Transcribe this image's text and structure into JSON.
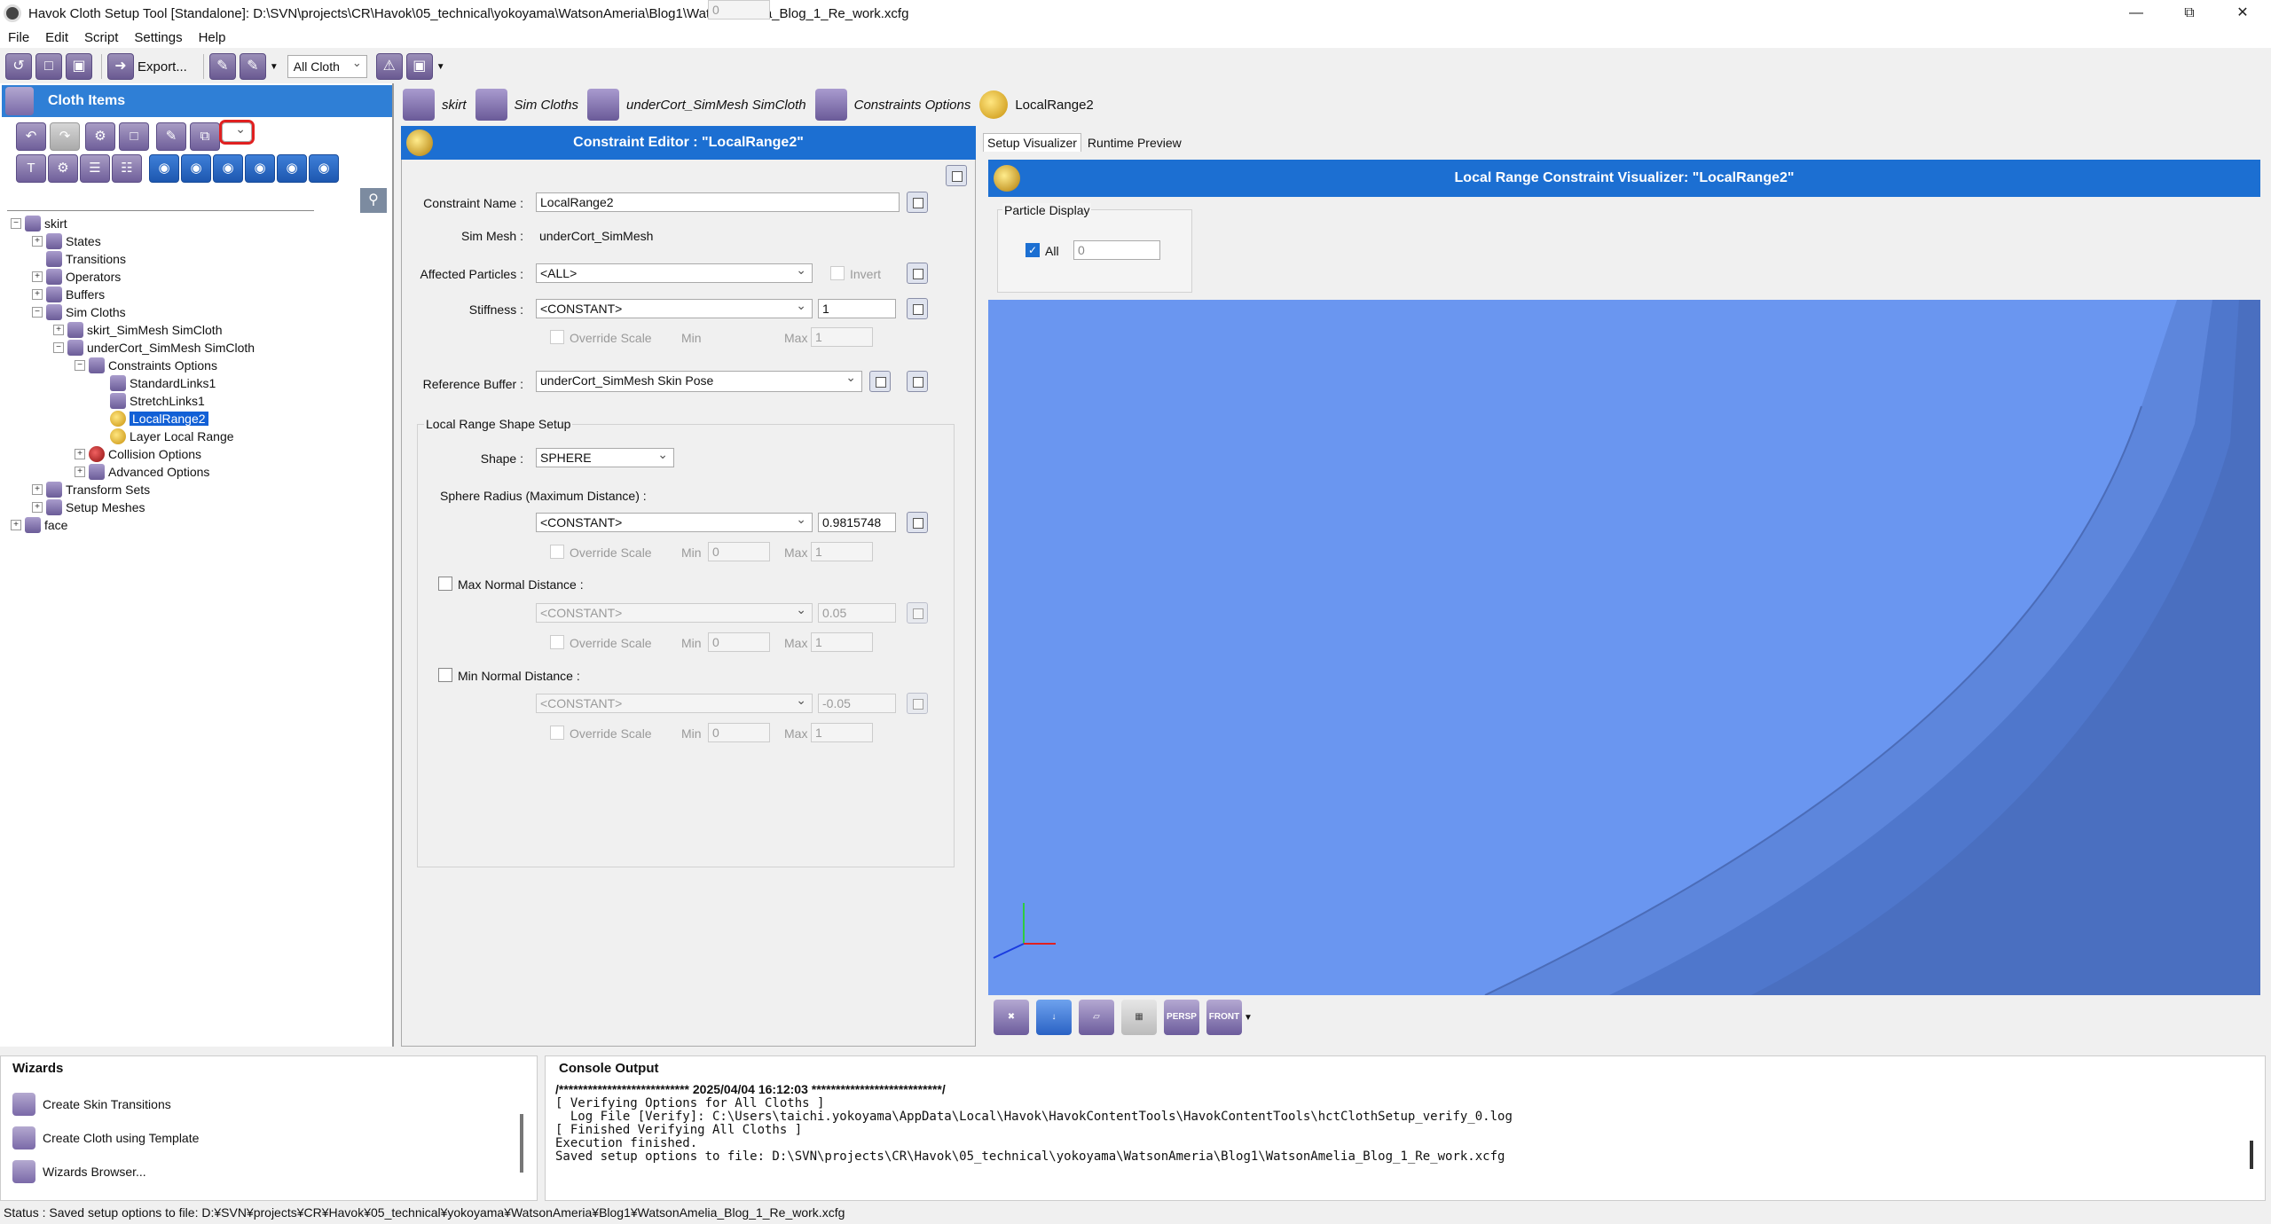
{
  "window": {
    "title": "Havok Cloth Setup Tool [Standalone]: D:\\SVN\\projects\\CR\\Havok\\05_technical\\yokoyama\\WatsonAmeria\\Blog1\\WatsonAmelia_Blog_1_Re_work.xcfg",
    "minimize": "—",
    "maximize": "⧉",
    "close": "✕"
  },
  "menu": [
    "File",
    "Edit",
    "Script",
    "Settings",
    "Help"
  ],
  "toolbar": {
    "export_label": "Export...",
    "cloth_filter": "All Cloth"
  },
  "cloth_items": {
    "title": "Cloth Items",
    "search_icon": "search-icon",
    "tree": [
      {
        "label": "skirt",
        "expander": "−"
      },
      {
        "label": "States",
        "expander": "+"
      },
      {
        "label": "Transitions",
        "expander": ""
      },
      {
        "label": "Operators",
        "expander": "+"
      },
      {
        "label": "Buffers",
        "expander": "+"
      },
      {
        "label": "Sim Cloths",
        "expander": "−"
      },
      {
        "label": "skirt_SimMesh SimCloth",
        "expander": "+"
      },
      {
        "label": "underCort_SimMesh SimCloth",
        "expander": "−"
      },
      {
        "label": "Constraints Options",
        "expander": "−"
      },
      {
        "label": "StandardLinks1",
        "expander": ""
      },
      {
        "label": "StretchLinks1",
        "expander": ""
      },
      {
        "label": "LocalRange2",
        "expander": ""
      },
      {
        "label": "Layer Local Range",
        "expander": ""
      },
      {
        "label": "Collision Options",
        "expander": "+"
      },
      {
        "label": "Advanced Options",
        "expander": "+"
      },
      {
        "label": "Transform Sets",
        "expander": "+"
      },
      {
        "label": "Setup Meshes",
        "expander": "+"
      },
      {
        "label": "face",
        "expander": "+"
      }
    ]
  },
  "breadcrumb_tabs": [
    "skirt",
    "Sim Cloths",
    "underCort_SimMesh SimCloth",
    "Constraints Options",
    "LocalRange2"
  ],
  "editor": {
    "title": "Constraint Editor : \"LocalRange2\"",
    "constraint_name_label": "Constraint Name :",
    "constraint_name_value": "LocalRange2",
    "sim_mesh_label": "Sim Mesh :",
    "sim_mesh_value": "underCort_SimMesh",
    "affected_particles_label": "Affected Particles :",
    "affected_particles_value": "<ALL>",
    "invert_label": "Invert",
    "stiffness_label": "Stiffness :",
    "stiffness_mode": "<CONSTANT>",
    "stiffness_value": "1",
    "override_scale_label": "Override Scale",
    "min_label": "Min",
    "max_label": "Max",
    "min_value": "0",
    "max_value": "1",
    "reference_buffer_label": "Reference Buffer :",
    "reference_buffer_value": "underCort_SimMesh Skin Pose",
    "shape_group_label": "Local Range Shape Setup",
    "shape_label": "Shape :",
    "shape_value": "SPHERE",
    "sphere_radius_label": "Sphere Radius (Maximum Distance) :",
    "sphere_radius_mode": "<CONSTANT>",
    "sphere_radius_value": "0.9815748",
    "max_normal_label": "Max Normal Distance :",
    "max_normal_mode": "<CONSTANT>",
    "max_normal_value": "0.05",
    "min_normal_label": "Min Normal Distance :",
    "min_normal_mode": "<CONSTANT>",
    "min_normal_value": "-0.05"
  },
  "visualizer": {
    "tab_setup": "Setup Visualizer",
    "tab_runtime": "Runtime Preview",
    "title": "Local Range Constraint Visualizer: \"LocalRange2\"",
    "particle_display_label": "Particle Display",
    "all_label": "All",
    "particle_value": "0",
    "viewport_color": "#6a96f0",
    "persp_label": "PERSP",
    "front_label": "FRONT"
  },
  "wizards": {
    "title": "Wizards",
    "items": [
      "Create Skin Transitions",
      "Create Cloth using Template",
      "Wizards Browser..."
    ]
  },
  "console": {
    "title": "Console Output",
    "lines": [
      "/*************************** 2025/04/04 16:12:03 ***************************/",
      "[ Verifying Options for All Cloths ]",
      "  Log File [Verify]: C:\\Users\\taichi.yokoyama\\AppData\\Local\\Havok\\HavokContentTools\\HavokContentTools\\hctClothSetup_verify_0.log",
      "[ Finished Verifying All Cloths ]",
      "Execution finished.",
      "Saved setup options to file: D:\\SVN\\projects\\CR\\Havok\\05_technical\\yokoyama\\WatsonAmeria\\Blog1\\WatsonAmelia_Blog_1_Re_work.xcfg"
    ]
  },
  "status": "Status : Saved setup options to file: D:¥SVN¥projects¥CR¥Havok¥05_technical¥yokoyama¥WatsonAmeria¥Blog1¥WatsonAmelia_Blog_1_Re_work.xcfg",
  "colors": {
    "accent": "#1c6fd2",
    "header_blue": "#2f7fd6",
    "selection": "#1260d6"
  }
}
